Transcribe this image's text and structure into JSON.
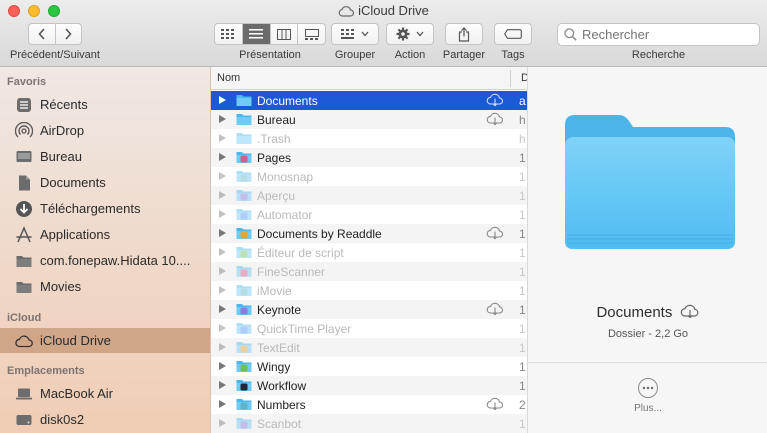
{
  "window": {
    "title": "iCloud Drive"
  },
  "toolbar": {
    "nav_label": "Précédent/Suivant",
    "view_label": "Présentation",
    "group_label": "Grouper",
    "action_label": "Action",
    "share_label": "Partager",
    "tags_label": "Tags",
    "search_label": "Recherche",
    "search_placeholder": "Rechercher"
  },
  "sidebar": {
    "favorites_header": "Favoris",
    "favorites": [
      {
        "label": "Récents",
        "icon": "recents-icon"
      },
      {
        "label": "AirDrop",
        "icon": "airdrop-icon"
      },
      {
        "label": "Bureau",
        "icon": "desktop-icon"
      },
      {
        "label": "Documents",
        "icon": "document-icon"
      },
      {
        "label": "Téléchargements",
        "icon": "download-icon"
      },
      {
        "label": "Applications",
        "icon": "applications-icon"
      },
      {
        "label": "com.fonepaw.Hidata 10....",
        "icon": "folder-icon"
      },
      {
        "label": "Movies",
        "icon": "folder-icon"
      }
    ],
    "icloud_header": "iCloud",
    "icloud_item": "iCloud Drive",
    "locations_header": "Emplacements",
    "locations": [
      {
        "label": "MacBook Air",
        "icon": "laptop-icon"
      },
      {
        "label": "disk0s2",
        "icon": "disk-icon"
      }
    ]
  },
  "list": {
    "col_name": "Nom",
    "col_date": "D",
    "rows": [
      {
        "name": "Documents",
        "date": "a",
        "cloud": true,
        "dim": false,
        "kind": "folder"
      },
      {
        "name": "Bureau",
        "date": "h",
        "cloud": true,
        "dim": false,
        "kind": "folder"
      },
      {
        "name": ".Trash",
        "date": "h",
        "cloud": false,
        "dim": true,
        "kind": "folder"
      },
      {
        "name": "Pages",
        "date": "1",
        "cloud": false,
        "dim": false,
        "kind": "app"
      },
      {
        "name": "Monosnap",
        "date": "1",
        "cloud": false,
        "dim": true,
        "kind": "app"
      },
      {
        "name": "Aperçu",
        "date": "1",
        "cloud": false,
        "dim": true,
        "kind": "app"
      },
      {
        "name": "Automator",
        "date": "1",
        "cloud": false,
        "dim": true,
        "kind": "app"
      },
      {
        "name": "Documents by Readdle",
        "date": "1",
        "cloud": true,
        "dim": false,
        "kind": "app"
      },
      {
        "name": "Éditeur de script",
        "date": "1",
        "cloud": false,
        "dim": true,
        "kind": "app"
      },
      {
        "name": "FineScanner",
        "date": "1",
        "cloud": false,
        "dim": true,
        "kind": "app"
      },
      {
        "name": "iMovie",
        "date": "1",
        "cloud": false,
        "dim": true,
        "kind": "app"
      },
      {
        "name": "Keynote",
        "date": "1",
        "cloud": true,
        "dim": false,
        "kind": "app"
      },
      {
        "name": "QuickTime Player",
        "date": "1",
        "cloud": false,
        "dim": true,
        "kind": "app"
      },
      {
        "name": "TextEdit",
        "date": "1",
        "cloud": false,
        "dim": true,
        "kind": "app"
      },
      {
        "name": "Wingy",
        "date": "1",
        "cloud": false,
        "dim": false,
        "kind": "app"
      },
      {
        "name": "Workflow",
        "date": "1",
        "cloud": false,
        "dim": false,
        "kind": "app-dark"
      },
      {
        "name": "Numbers",
        "date": "2",
        "cloud": true,
        "dim": false,
        "kind": "app"
      },
      {
        "name": "Scanbot",
        "date": "1",
        "cloud": false,
        "dim": true,
        "kind": "app"
      }
    ]
  },
  "preview": {
    "name": "Documents",
    "info": "Dossier - 2,2 Go",
    "more_label": "Plus..."
  },
  "colors": {
    "selection": "#1d59d6",
    "sidebar_selection": "#d1a688",
    "folder": "#5ec6f5"
  }
}
